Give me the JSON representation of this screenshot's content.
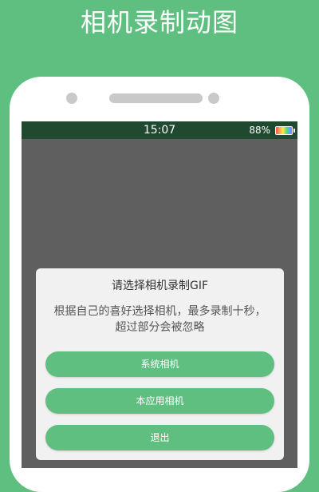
{
  "headline": "相机录制动图",
  "colors": {
    "brand_green": "#5fbf80",
    "status_bar": "#1f4a30",
    "screen_bg": "#5f5f5f",
    "dialog_bg": "#f1f1f1"
  },
  "status_bar": {
    "time": "15:07",
    "battery_percent": "88%",
    "battery_icon": "battery-icon"
  },
  "dialog": {
    "title": "请选择相机录制GIF",
    "message": "根据自己的喜好选择相机，最多录制十秒，超过部分会被忽略",
    "buttons": [
      {
        "label": "系统相机"
      },
      {
        "label": "本应用相机"
      },
      {
        "label": "退出"
      }
    ]
  }
}
